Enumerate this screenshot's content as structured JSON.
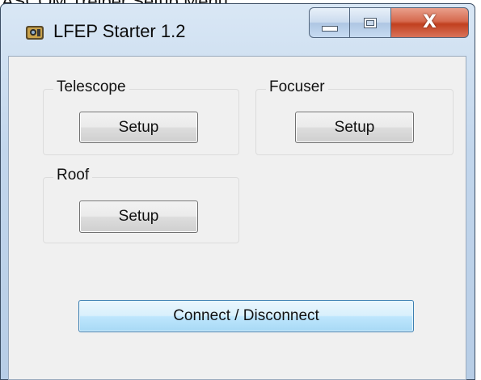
{
  "page_caption": "ASCOM Trelber Setup Menu",
  "window": {
    "title": "LFEP Starter 1.2",
    "icon": "telescope-app-icon",
    "controls": {
      "minimize": "minimize-icon",
      "maximize": "maximize-icon",
      "close": "X"
    }
  },
  "groups": {
    "telescope": {
      "label": "Telescope",
      "button": "Setup"
    },
    "focuser": {
      "label": "Focuser",
      "button": "Setup"
    },
    "roof": {
      "label": "Roof",
      "button": "Setup"
    }
  },
  "connect_button": "Connect / Disconnect",
  "colors": {
    "client_background": "#f0f0f0",
    "titlebar": "#c2d6ec",
    "close_button": "#c1401f",
    "default_button_border": "#3c7fb1"
  }
}
